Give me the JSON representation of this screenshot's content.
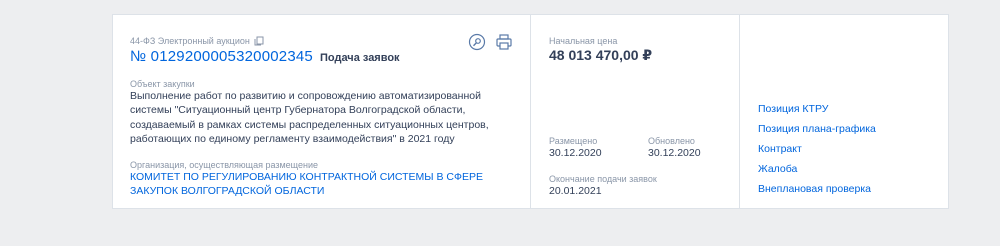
{
  "header": {
    "law_type": "44-ФЗ Электронный аукцион",
    "reg_number": "№ 0129200005320002345",
    "status": "Подача заявок"
  },
  "object": {
    "label": "Объект закупки",
    "text": "Выполнение работ по развитию и сопровождению автоматизированной системы \"Ситуационный центр Губернатора Волгоградской области, создаваемый в рамках системы распределенных ситуационных центров, работающих по единому регламенту взаимодействия\" в 2021 году"
  },
  "organization": {
    "label": "Организация, осуществляющая размещение",
    "name": "КОМИТЕТ ПО РЕГУЛИРОВАНИЮ КОНТРАКТНОЙ СИСТЕМЫ В СФЕРЕ ЗАКУПОК ВОЛГОГРАДСКОЙ ОБЛАСТИ"
  },
  "price": {
    "label": "Начальная цена",
    "value": "48 013 470,00 ₽"
  },
  "dates": {
    "posted_label": "Размещено",
    "posted_value": "30.12.2020",
    "updated_label": "Обновлено",
    "updated_value": "30.12.2020",
    "deadline_label": "Окончание подачи заявок",
    "deadline_value": "20.01.2021"
  },
  "links": [
    "Позиция КТРУ",
    "Позиция плана-графика",
    "Контракт",
    "Жалоба",
    "Внеплановая проверка"
  ],
  "icons": {
    "copy": "copy-icon",
    "view": "search-doc-icon",
    "print": "print-icon"
  },
  "colors": {
    "link": "#0065dd",
    "text": "#334059",
    "muted": "#8a96a8",
    "background": "#edeef0"
  }
}
